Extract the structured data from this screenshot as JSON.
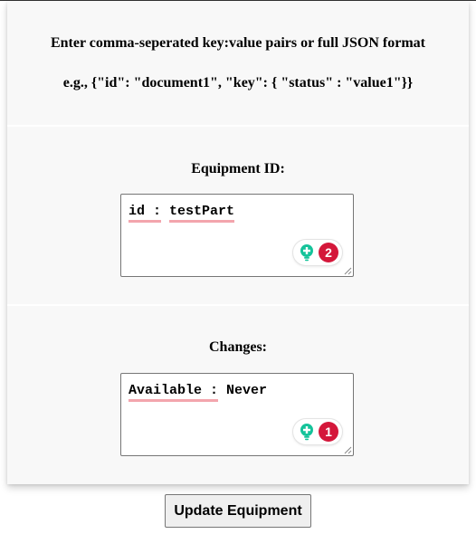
{
  "instructions": {
    "line1": "Enter comma-seperated key:value pairs or full JSON format",
    "line2": "e.g., {\"id\": \"document1\", \"key\": { \"status\" : \"value1\"}}"
  },
  "equipment": {
    "label": "Equipment ID:",
    "value_key": "id :",
    "value_sep": " ",
    "value_val": "testPart",
    "issue_count": "2"
  },
  "changes": {
    "label": "Changes:",
    "value_key": "Available :",
    "value_rest": " Never",
    "issue_count": "1"
  },
  "update_button": {
    "label": "Update Equipment"
  },
  "colors": {
    "panel_bg": "#f8f8f8",
    "badge_red": "#d4173a",
    "bulb_teal": "#15c39a",
    "squiggle": "#f3a5ad"
  },
  "icons": {
    "assistant": "lightbulb-plus-icon",
    "resize": "resize-handle-icon"
  }
}
